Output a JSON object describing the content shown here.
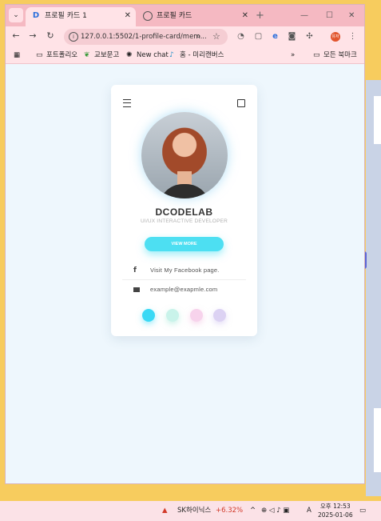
{
  "browser": {
    "tabs": [
      {
        "favicon": "D",
        "label": "프로필 카드 1",
        "active": true
      },
      {
        "favicon": "globe",
        "label": "프로필 카드",
        "active": false
      }
    ],
    "new_tab": "+",
    "window_controls": {
      "minimize": "—",
      "maximize": "☐",
      "close": "✕"
    },
    "url": "127.0.0.1:5502/1-profile-card/mem...",
    "profile_initials": "유저"
  },
  "bookmarks": {
    "items": [
      {
        "icon": "folder-icon",
        "label": "포트폴리오"
      },
      {
        "icon": "leaf-icon",
        "label": "교보문고"
      },
      {
        "icon": "chat-icon",
        "label": "New chat"
      },
      {
        "icon": "tiktok-icon",
        "label": "홈 - 미리캔버스"
      }
    ],
    "more": "»",
    "all_bookmarks": "모든 북마크"
  },
  "card": {
    "name": "DCODELAB",
    "role": "UI/UX INTERACTIVE DEVELOPER",
    "button_label": "VIEW MORE",
    "facebook_text": "Visit My Facebook page.",
    "email_text": "example@exapmle.com",
    "colors": {
      "accent": "#4ddff2",
      "dots": [
        "#3ad9f5",
        "#c9f3ea",
        "#f7d3ec",
        "#dcd2f3"
      ]
    }
  },
  "taskbar": {
    "stock_name": "SK하이닉스",
    "stock_change": "+6.32%",
    "time": "오후 12:53",
    "date": "2025-01-06",
    "lang": "A"
  }
}
